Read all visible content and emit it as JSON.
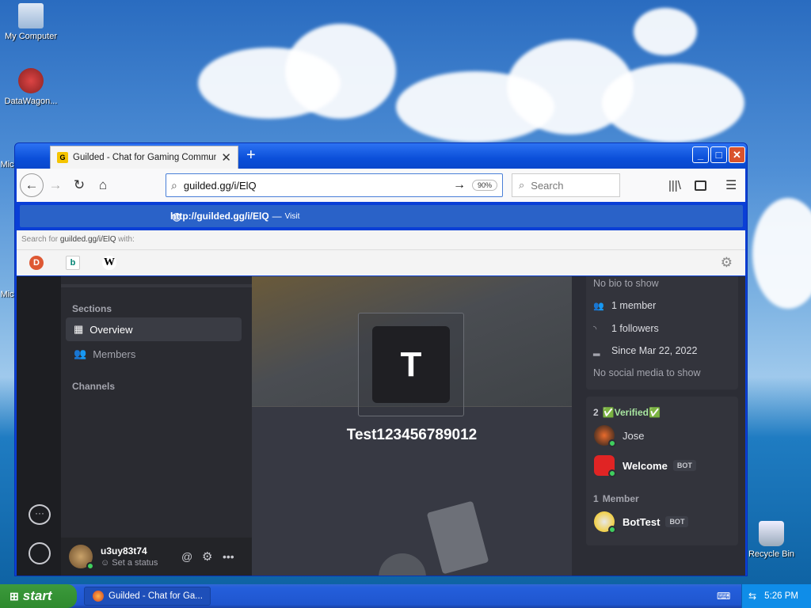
{
  "desktop": {
    "icons": [
      {
        "label": "My Computer"
      },
      {
        "label": "DataWagon..."
      },
      {
        "label": "Mic"
      },
      {
        "label": "Mic"
      },
      {
        "label": "Recycle Bin"
      }
    ]
  },
  "browser": {
    "tab_title": "Guilded - Chat for Gaming Commun",
    "url": "guilded.gg/i/ElQ",
    "zoom": "90%",
    "search_placeholder": "Search",
    "suggestion": {
      "url_prefix": "http://",
      "url_bold": "guilded.gg/i/ElQ",
      "dash": "—",
      "action": "Visit"
    },
    "search_with": {
      "prefix": "Search for ",
      "term": "guilded.gg/i/ElQ",
      "suffix": " with:"
    },
    "engines": [
      "DuckDuckGo",
      "Bing",
      "Wikipedia"
    ]
  },
  "guilded": {
    "sidebar": {
      "sections_label": "Sections",
      "items": [
        {
          "label": "Overview"
        },
        {
          "label": "Members"
        }
      ],
      "channels_label": "Channels"
    },
    "user": {
      "name": "u3uy83t74",
      "status": "Set a status"
    },
    "team": {
      "initial": "T",
      "name": "Test123456789012"
    },
    "about": {
      "bio": "No bio to show",
      "members": "1 member",
      "followers": "1 followers",
      "since": "Since Mar 22, 2022",
      "social": "No social media to show"
    },
    "groups": [
      {
        "count": "2",
        "label": "✅Verified✅",
        "members": [
          {
            "name": "Jose",
            "bot": ""
          },
          {
            "name": "Welcome",
            "bot": "BOT"
          }
        ]
      },
      {
        "count": "1",
        "label": "Member",
        "members": [
          {
            "name": "BotTest",
            "bot": "BOT"
          }
        ]
      }
    ]
  },
  "taskbar": {
    "start": "start",
    "task": "Guilded - Chat for Ga...",
    "time": "5:26 PM"
  }
}
